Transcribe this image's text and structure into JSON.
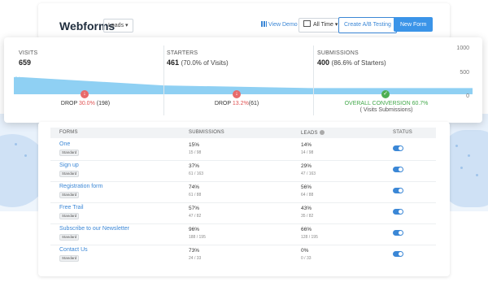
{
  "header": {
    "title": "Webforms",
    "leads_select": "Leads",
    "view_demo": "View Demo",
    "time_range": "All Time",
    "ab_testing": "Create A/B Testing",
    "new_form": "New Form"
  },
  "funnel": {
    "stages": [
      {
        "label": "VISITS",
        "value": "659",
        "detail": ""
      },
      {
        "label": "STARTERS",
        "value": "461",
        "detail": "(70.0% of Visits)"
      },
      {
        "label": "SUBMISSIONS",
        "value": "400",
        "detail": "(86.6% of Starters)"
      }
    ],
    "axis": [
      "1000",
      "500",
      "0"
    ],
    "axis_max": 1000,
    "values": [
      659,
      461,
      400
    ],
    "drops": [
      {
        "label": "DROP",
        "pct": "30.0%",
        "count": "(198)"
      },
      {
        "label": "DROP",
        "pct": "13.2%",
        "count": "(61)"
      }
    ],
    "conversion": {
      "label": "OVERALL CONVERSION 60.7%",
      "sub": "( Visits Submissions)"
    },
    "colors": {
      "fill": "#8fd0f3",
      "red": "#e05252",
      "green": "#42a84a"
    }
  },
  "table": {
    "headers": {
      "forms": "FORMS",
      "submissions": "SUBMISSIONS",
      "leads": "LEADS",
      "status": "STATUS"
    },
    "rows": [
      {
        "name": "One",
        "tag": "Standard",
        "sub_pct": "15%",
        "sub_frac": "15 / 98",
        "lead_pct": "14%",
        "lead_frac": "14 / 98"
      },
      {
        "name": "Sign up",
        "tag": "Standard",
        "sub_pct": "37%",
        "sub_frac": "61 / 163",
        "lead_pct": "29%",
        "lead_frac": "47 / 163"
      },
      {
        "name": "Registration form",
        "tag": "Standard",
        "sub_pct": "74%",
        "sub_frac": "61 / 88",
        "lead_pct": "56%",
        "lead_frac": "64 / 88"
      },
      {
        "name": "Free Trail",
        "tag": "Standard",
        "sub_pct": "57%",
        "sub_frac": "47 / 82",
        "lead_pct": "43%",
        "lead_frac": "35 / 82"
      },
      {
        "name": "Subscribe to our Newsletter",
        "tag": "Standard",
        "sub_pct": "96%",
        "sub_frac": "188 / 195",
        "lead_pct": "66%",
        "lead_frac": "128 / 195"
      },
      {
        "name": "Contact Us",
        "tag": "Standard",
        "sub_pct": "73%",
        "sub_frac": "24 / 33",
        "lead_pct": "0%",
        "lead_frac": "0 / 33"
      }
    ]
  }
}
